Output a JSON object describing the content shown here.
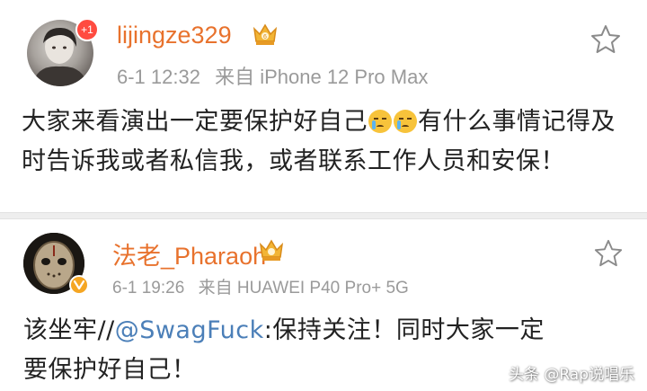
{
  "posts": [
    {
      "username": "lijingze329",
      "notification_badge": "+1",
      "time": "6-1 12:32",
      "source": "来自 iPhone 12 Pro Max",
      "body_part1": "大家来看演出一定要保护好自己",
      "body_part2": "有什么事情记得及时告诉我或者私信我，或者联系工作人员和安保！",
      "emojis": [
        "crying-emoji",
        "crying-emoji"
      ]
    },
    {
      "username": "法老_Pharaoh",
      "time": "6-1 19:26",
      "source": "来自 HUAWEI P40 Pro+ 5G",
      "body_prefix": "该坐牢//",
      "mention": "@SwagFuck",
      "body_suffix": ":保持关注！同时大家一定要保护好自己！"
    }
  ],
  "watermark": "头条 @Rap说唱乐",
  "colors": {
    "username": "#e8722d",
    "meta": "#9a9a9a",
    "mention": "#4b7fb8",
    "badge": "#ff4b40",
    "verified": "#f5a623"
  },
  "icons": [
    "star-icon",
    "crown-badge-icon",
    "verified-icon"
  ]
}
